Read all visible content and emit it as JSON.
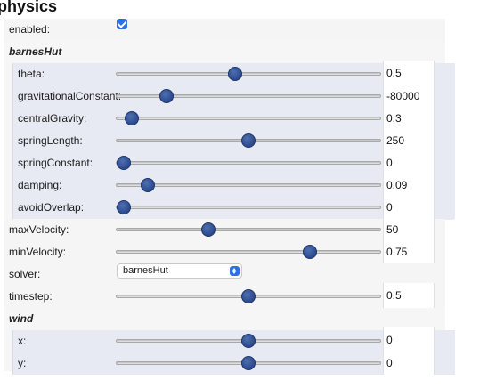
{
  "header": {
    "title": "physics"
  },
  "enabled": {
    "label": "enabled:",
    "checked": true
  },
  "barnesHut": {
    "title": "barnesHut",
    "params": [
      {
        "name": "theta",
        "label": "theta:",
        "value": "0.5",
        "fraction": 0.45
      },
      {
        "name": "gravitationalConstant",
        "label": "gravitationalConstant:",
        "value": "-80000",
        "fraction": 0.19
      },
      {
        "name": "centralGravity",
        "label": "centralGravity:",
        "value": "0.3",
        "fraction": 0.06
      },
      {
        "name": "springLength",
        "label": "springLength:",
        "value": "250",
        "fraction": 0.5
      },
      {
        "name": "springConstant",
        "label": "springConstant:",
        "value": "0",
        "fraction": 0.03
      },
      {
        "name": "damping",
        "label": "damping:",
        "value": "0.09",
        "fraction": 0.12
      },
      {
        "name": "avoidOverlap",
        "label": "avoidOverlap:",
        "value": "0",
        "fraction": 0.03
      }
    ]
  },
  "maxVelocity": {
    "label": "maxVelocity:",
    "value": "50",
    "fraction": 0.35
  },
  "minVelocity": {
    "label": "minVelocity:",
    "value": "0.75",
    "fraction": 0.73
  },
  "solver": {
    "label": "solver:",
    "value": "barnesHut"
  },
  "timestep": {
    "label": "timestep:",
    "value": "0.5",
    "fraction": 0.5
  },
  "wind": {
    "title": "wind",
    "params": [
      {
        "name": "x",
        "label": "x:",
        "value": "0",
        "fraction": 0.5
      },
      {
        "name": "y",
        "label": "y:",
        "value": "0",
        "fraction": 0.5
      }
    ]
  }
}
